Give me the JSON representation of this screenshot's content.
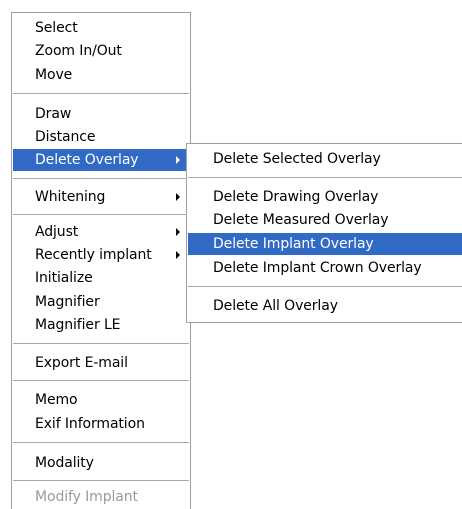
{
  "main_menu": {
    "items": [
      {
        "label": "Select"
      },
      {
        "label": "Zoom In/Out"
      },
      {
        "label": "Move"
      },
      {
        "label": "Draw"
      },
      {
        "label": "Distance"
      },
      {
        "label": "Delete Overlay",
        "submenu": true,
        "selected": true
      },
      {
        "label": "Whitening",
        "submenu": true
      },
      {
        "label": "Adjust",
        "submenu": true
      },
      {
        "label": "Recently implant",
        "submenu": true
      },
      {
        "label": "Initialize"
      },
      {
        "label": "Magnifier"
      },
      {
        "label": "Magnifier LE"
      },
      {
        "label": "Export E-mail"
      },
      {
        "label": "Memo"
      },
      {
        "label": "Exif Information"
      },
      {
        "label": "Modality"
      },
      {
        "label": "Modify Implant",
        "disabled": true
      }
    ]
  },
  "sub_menu": {
    "items": [
      {
        "label": "Delete Selected Overlay"
      },
      {
        "label": "Delete Drawing Overlay"
      },
      {
        "label": "Delete Measured Overlay"
      },
      {
        "label": "Delete Implant Overlay",
        "selected": true
      },
      {
        "label": "Delete Implant Crown Overlay"
      },
      {
        "label": "Delete All Overlay"
      }
    ]
  },
  "colors": {
    "highlight": "#316ac5",
    "highlight_text": "#ffffff",
    "disabled_text": "#9a9a9a",
    "separator": "#a8a8a8"
  }
}
